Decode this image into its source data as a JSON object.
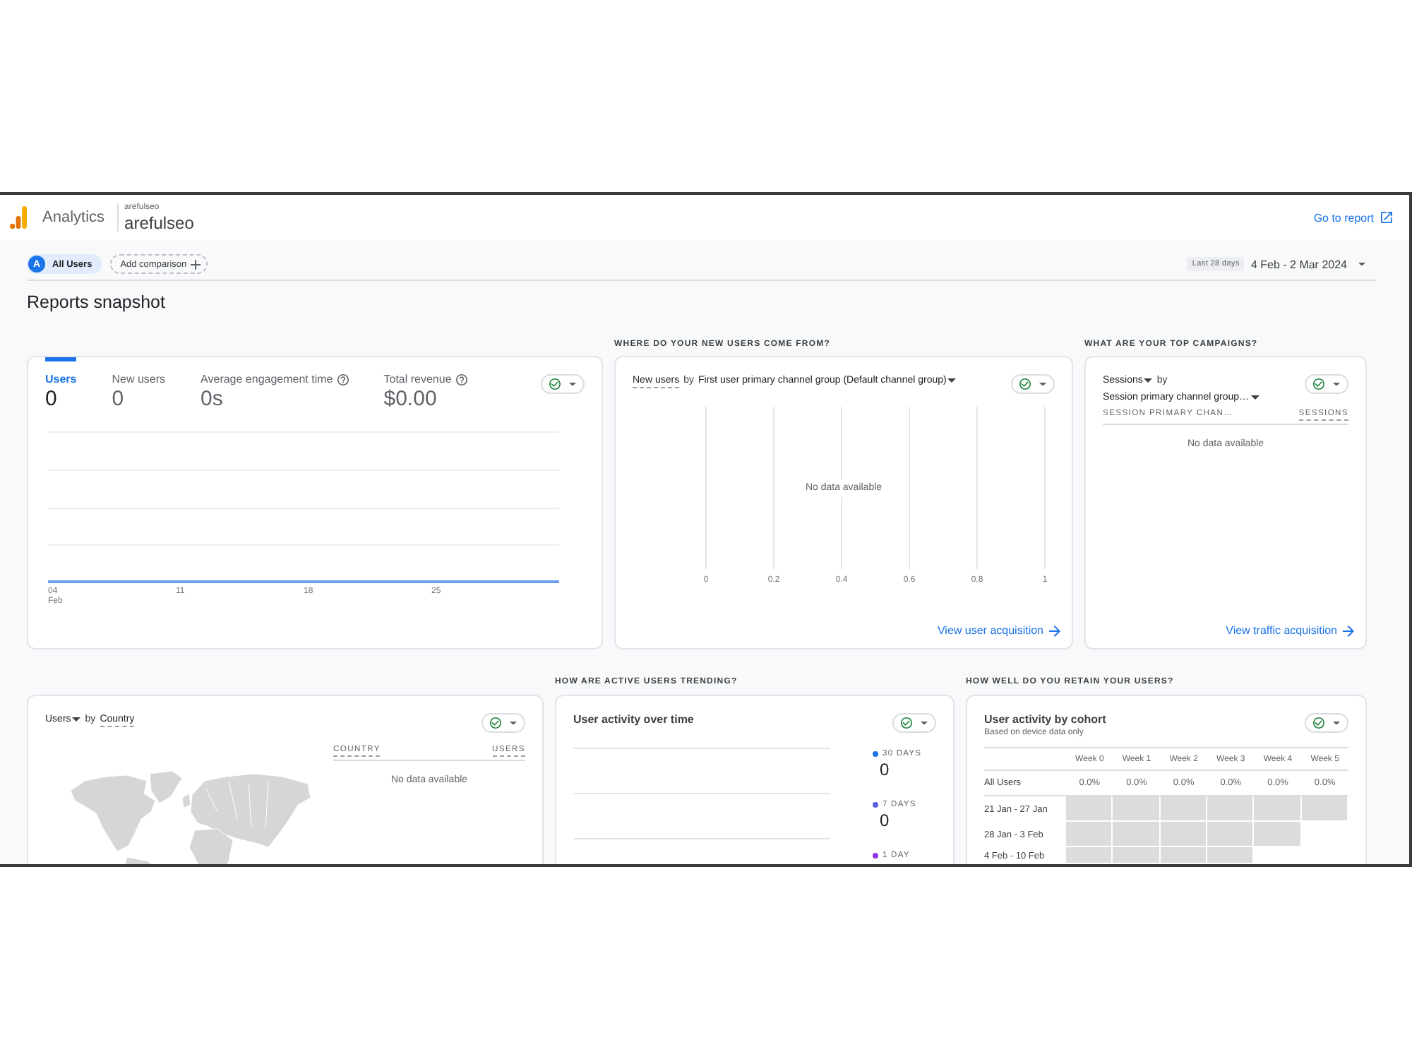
{
  "header": {
    "product": "Analytics",
    "account": "arefulseo",
    "property": "arefulseo",
    "report_link": "Go to report"
  },
  "filters": {
    "segment": {
      "badge": "A",
      "label": "All Users"
    },
    "add_comparison": "Add comparison",
    "date_preset": "Last 28 days",
    "date_range": "4 Feb - 2 Mar 2024"
  },
  "page_title": "Reports snapshot",
  "rows": [
    {
      "cards": [
        {
          "kind": "metrics",
          "metrics": [
            {
              "label": "Users",
              "value": "0",
              "selected": true,
              "help": false
            },
            {
              "label": "New users",
              "value": "0",
              "selected": false,
              "help": false
            },
            {
              "label": "Average engagement time",
              "value": "0s",
              "selected": false,
              "help": true
            },
            {
              "label": "Total revenue",
              "value": "$0.00",
              "selected": false,
              "help": true
            }
          ],
          "date_ticks": [
            {
              "day": "04",
              "month": "Feb"
            },
            {
              "day": "11"
            },
            {
              "day": "18"
            },
            {
              "day": "25"
            }
          ]
        },
        {
          "kind": "bar",
          "caption": "WHERE DO YOUR NEW USERS COME FROM?",
          "title": {
            "metric": {
              "text": "New users",
              "caret": false,
              "underline": true
            },
            "joiner": "by",
            "dimension": {
              "text": "First user primary channel group (Default channel group)",
              "caret": true,
              "underline": false
            }
          },
          "ticks": [
            "0",
            "0.2",
            "0.4",
            "0.6",
            "0.8",
            "1"
          ],
          "empty": "No data available",
          "link": "View user acquisition"
        },
        {
          "kind": "table",
          "caption": "WHAT ARE YOUR TOP CAMPAIGNS?",
          "title": {
            "metric": {
              "text": "Sessions",
              "caret": true,
              "underline": false
            },
            "joiner": "by",
            "dimension": {
              "text": "Session primary channel group…",
              "caret": true,
              "underline": false
            }
          },
          "columns": [
            {
              "label": "SESSION PRIMARY CHAN…",
              "underline": false
            },
            {
              "label": "SESSIONS",
              "underline": true
            }
          ],
          "empty": "No data available",
          "link": "View traffic acquisition"
        }
      ]
    },
    {
      "cards": [
        {
          "kind": "map",
          "title": {
            "metric": {
              "text": "Users",
              "caret": true,
              "underline": false
            },
            "joiner": "by",
            "dimension": {
              "text": "Country",
              "caret": false,
              "underline": true
            }
          },
          "columns": [
            {
              "label": "COUNTRY",
              "underline": true
            },
            {
              "label": "USERS",
              "underline": true
            }
          ],
          "empty": "No data available"
        },
        {
          "kind": "activity",
          "caption": "HOW ARE ACTIVE USERS TRENDING?",
          "title": "User activity over time",
          "legend": [
            {
              "label": "30 DAYS",
              "value": "0",
              "color": "#1a73e8"
            },
            {
              "label": "7 DAYS",
              "value": "0",
              "color": "#5c61e0"
            },
            {
              "label": "1 DAY",
              "color": "#9334e6"
            }
          ]
        },
        {
          "kind": "cohort",
          "caption": "HOW WELL DO YOU RETAIN YOUR USERS?",
          "title": "User activity by cohort",
          "subtitle": "Based on device data only",
          "weeks": [
            "Week 0",
            "Week 1",
            "Week 2",
            "Week 3",
            "Week 4",
            "Week 5"
          ],
          "total": {
            "label": "All Users",
            "values": [
              "0.0%",
              "0.0%",
              "0.0%",
              "0.0%",
              "0.0%",
              "0.0%"
            ]
          },
          "cohorts": [
            {
              "label": "21 Jan - 27 Jan",
              "cells": [
                {
                  "filled": true
                },
                {
                  "filled": true
                },
                {
                  "filled": true
                },
                {
                  "filled": true
                },
                {
                  "filled": true
                },
                {
                  "filled": true
                }
              ]
            },
            {
              "label": "28 Jan - 3 Feb",
              "cells": [
                {
                  "filled": true
                },
                {
                  "filled": true
                },
                {
                  "filled": true
                },
                {
                  "filled": true
                },
                {
                  "filled": true
                },
                {
                  "filled": false
                }
              ]
            },
            {
              "label": "4 Feb - 10 Feb",
              "cells": [
                {
                  "filled": true
                },
                {
                  "filled": true
                },
                {
                  "filled": true
                },
                {
                  "filled": true
                },
                {
                  "filled": false
                },
                {
                  "filled": false
                }
              ]
            }
          ]
        }
      ]
    }
  ]
}
